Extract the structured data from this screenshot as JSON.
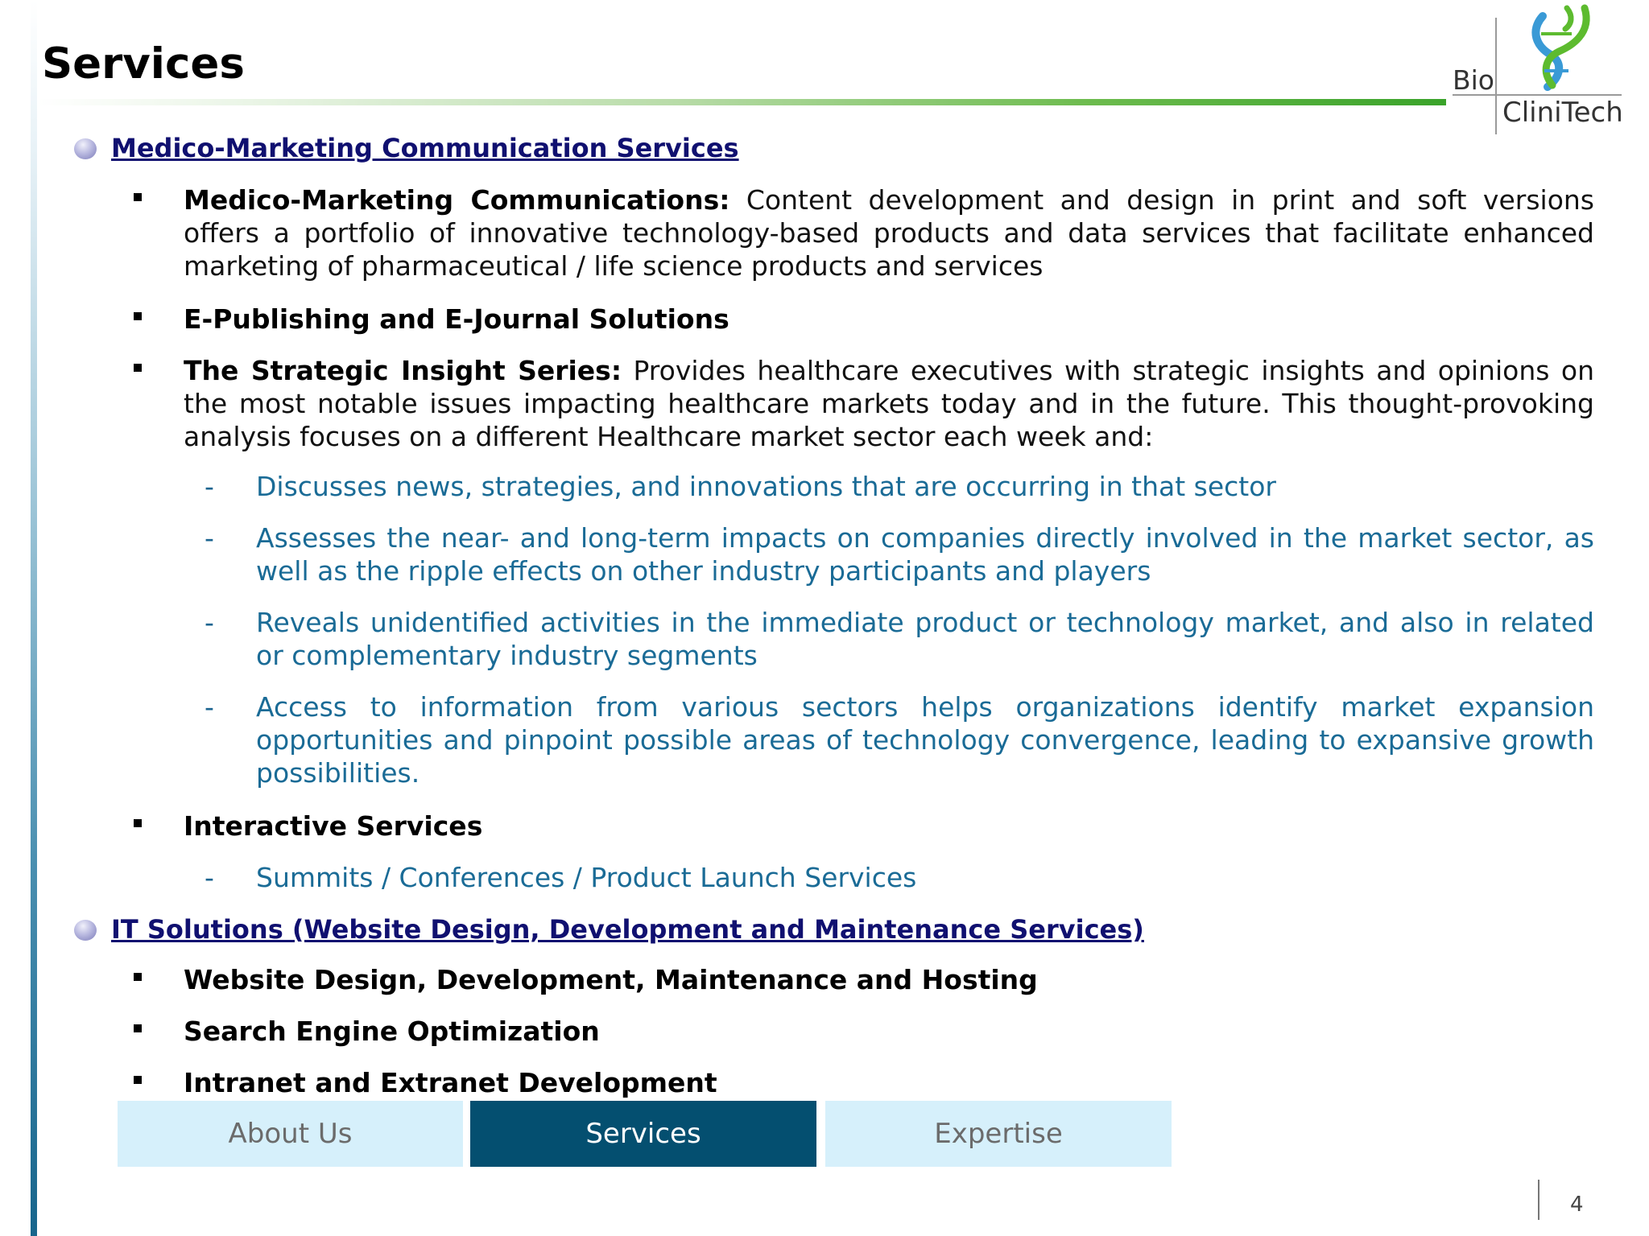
{
  "slide": {
    "title": "Services",
    "page_number": "4"
  },
  "logo": {
    "top_text": "Bio",
    "bottom_text": "CliniTech"
  },
  "sections": [
    {
      "heading": "Medico-Marketing Communication Services",
      "items": [
        {
          "bold": "Medico-Marketing Communications:",
          "text": " Content development and design in print and soft versions offers a portfolio of innovative technology-based products and data services that facilitate enhanced marketing of pharmaceutical / life science products and services"
        },
        {
          "bold": "E-Publishing and E-Journal Solutions",
          "text": ""
        },
        {
          "bold": "The Strategic Insight Series:",
          "text": " Provides healthcare executives with strategic insights and opinions on the most notable issues impacting healthcare markets today and in the future. This thought-provoking analysis focuses on a different Healthcare market sector each week and:",
          "subitems": [
            "Discusses news, strategies, and innovations that are occurring in that sector",
            "Assesses the near- and long-term impacts on companies directly involved in the market sector, as well as the ripple effects on other industry participants and players",
            "Reveals unidentified activities in the immediate product or technology market, and also in related or complementary industry segments",
            "Access to information from various sectors helps organizations identify market expansion opportunities and pinpoint possible areas of technology convergence, leading to expansive growth possibilities."
          ]
        },
        {
          "bold": "Interactive Services",
          "text": "",
          "subitems": [
            "Summits / Conferences / Product Launch Services"
          ]
        }
      ]
    },
    {
      "heading": "IT Solutions (Website Design, Development and Maintenance Services)",
      "items": [
        {
          "bold": "Website Design, Development, Maintenance and Hosting",
          "text": ""
        },
        {
          "bold": "Search Engine Optimization",
          "text": ""
        },
        {
          "bold": "Intranet and Extranet Development",
          "text": ""
        }
      ]
    }
  ],
  "nav_tabs": [
    {
      "label": "About Us",
      "active": false
    },
    {
      "label": "Services",
      "active": true
    },
    {
      "label": "Expertise",
      "active": false
    }
  ],
  "colors": {
    "heading": "#101070",
    "subitem": "#1a6b96",
    "active_tab": "#044f70",
    "inactive_tab": "#d6f0fb",
    "title_rule": "#3aa32a"
  },
  "dash_glyph": "-"
}
